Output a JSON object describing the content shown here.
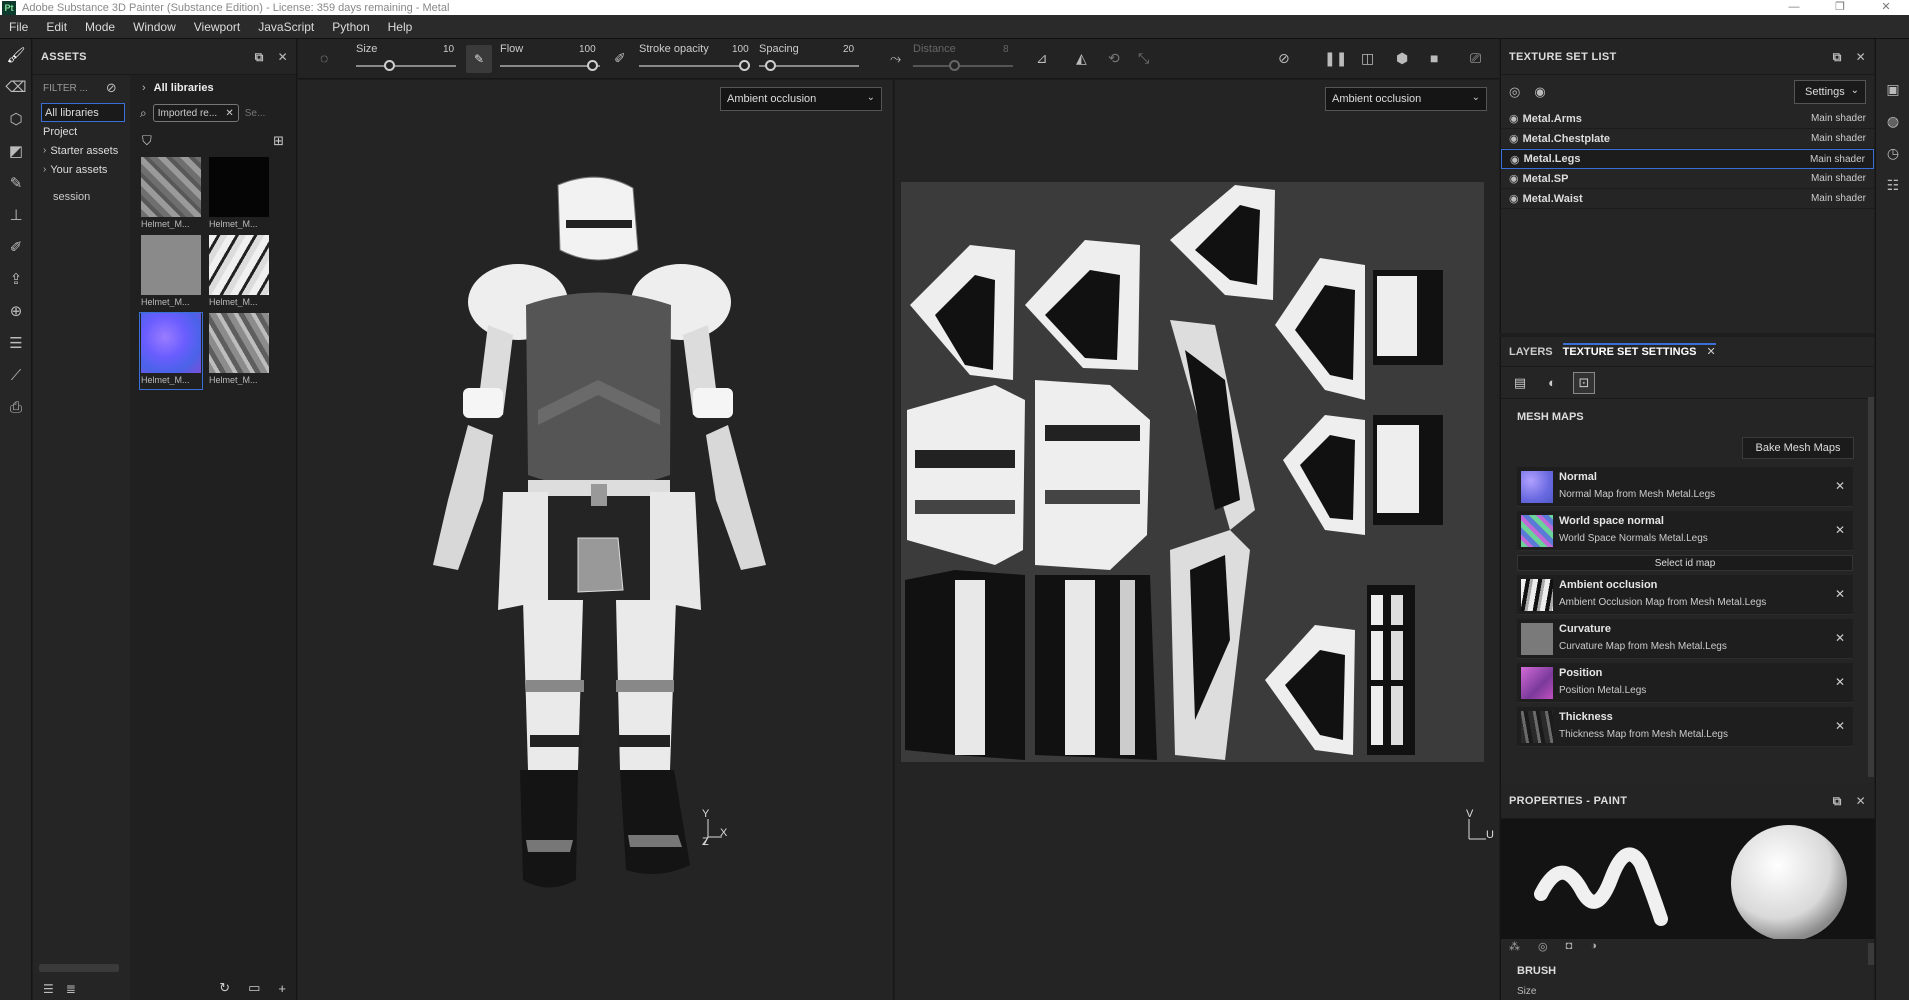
{
  "window": {
    "title": "Adobe Substance 3D Painter (Substance Edition) - License: 359 days remaining - Metal",
    "logo_text": "Pt",
    "controls": [
      "—",
      "❐",
      "✕"
    ]
  },
  "menu": [
    "File",
    "Edit",
    "Mode",
    "Window",
    "Viewport",
    "JavaScript",
    "Python",
    "Help"
  ],
  "assets": {
    "title": "ASSETS",
    "filter_label": "FILTER ...",
    "libraries": [
      {
        "label": "All libraries",
        "selected": true
      },
      {
        "label": "Project"
      },
      {
        "label": "Starter assets",
        "expandable": true
      },
      {
        "label": "Your assets",
        "expandable": true
      }
    ],
    "session_label": "session",
    "breadcrumb": "All libraries",
    "search_chip": "Imported re...",
    "search_placeholder": "Se...",
    "thumbnails": [
      {
        "caption": "Helmet_M...",
        "style": "t1"
      },
      {
        "caption": "Helmet_M...",
        "style": "t2"
      },
      {
        "caption": "Helmet_M...",
        "style": "t3"
      },
      {
        "caption": "Helmet_M...",
        "style": "t4"
      },
      {
        "caption": "Helmet_M...",
        "style": "t5",
        "selected": true
      },
      {
        "caption": "Helmet_M...",
        "style": "t6"
      }
    ]
  },
  "toolbar": {
    "size_label": "Size",
    "size_value": "10",
    "flow_label": "Flow",
    "flow_value": "100",
    "stroke_opacity_label": "Stroke opacity",
    "stroke_opacity_value": "100",
    "spacing_label": "Spacing",
    "spacing_value": "20",
    "distance_label": "Distance",
    "distance_value": "8"
  },
  "viewport3d": {
    "channel": "Ambient occlusion",
    "axis_y": "Y",
    "axis_x": "X",
    "axis_z": "Z"
  },
  "viewport2d": {
    "channel": "Ambient occlusion",
    "axis_v": "V",
    "axis_u": "U"
  },
  "texture_set_list": {
    "title": "TEXTURE SET LIST",
    "settings_label": "Settings",
    "items": [
      {
        "name": "Metal.Arms",
        "shader": "Main shader"
      },
      {
        "name": "Metal.Chestplate",
        "shader": "Main shader"
      },
      {
        "name": "Metal.Legs",
        "shader": "Main shader",
        "selected": true
      },
      {
        "name": "Metal.SP",
        "shader": "Main shader"
      },
      {
        "name": "Metal.Waist",
        "shader": "Main shader"
      }
    ]
  },
  "layers_panel": {
    "tab_layers": "LAYERS",
    "tab_tss": "TEXTURE SET SETTINGS",
    "mesh_maps_title": "MESH MAPS",
    "bake_button": "Bake Mesh Maps",
    "select_id_map": "Select id map",
    "maps": [
      {
        "name": "Normal",
        "desc": "Normal Map from Mesh Metal.Legs",
        "icon": "ic-normal"
      },
      {
        "name": "World space normal",
        "desc": "World Space Normals Metal.Legs",
        "icon": "ic-world"
      },
      {
        "name": "Ambient occlusion",
        "desc": "Ambient Occlusion Map from Mesh Metal.Legs",
        "icon": "ic-ao"
      },
      {
        "name": "Curvature",
        "desc": "Curvature Map from Mesh Metal.Legs",
        "icon": "ic-curv"
      },
      {
        "name": "Position",
        "desc": "Position Metal.Legs",
        "icon": "ic-pos"
      },
      {
        "name": "Thickness",
        "desc": "Thickness Map from Mesh Metal.Legs",
        "icon": "ic-thick"
      }
    ]
  },
  "properties": {
    "title": "PROPERTIES - PAINT",
    "brush_title": "BRUSH",
    "size_label": "Size"
  },
  "colors": {
    "accent": "#3a6fd6",
    "bg": "#1d1d1d",
    "panel": "#252525"
  }
}
